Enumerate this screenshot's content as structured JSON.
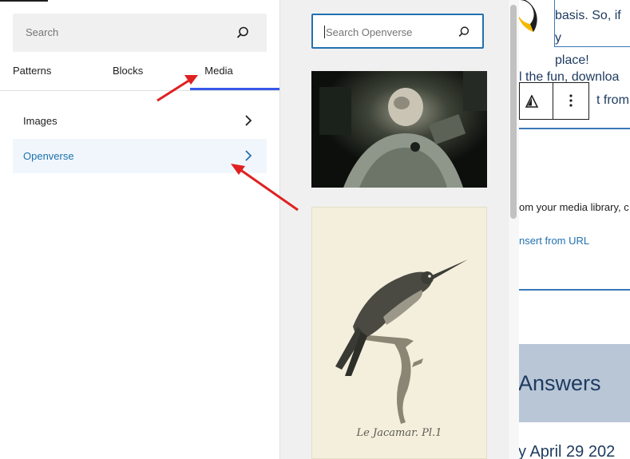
{
  "inserter": {
    "search_placeholder": "Search",
    "tabs": [
      {
        "label": "Patterns"
      },
      {
        "label": "Blocks"
      },
      {
        "label": "Media"
      }
    ],
    "active_tab": "Media",
    "categories": [
      {
        "label": "Images"
      },
      {
        "label": "Openverse"
      }
    ]
  },
  "media_panel": {
    "search_placeholder": "Search Openverse",
    "items": [
      {
        "kind": "photo",
        "subject": "astronaut"
      },
      {
        "kind": "engraving",
        "subject": "hummingbird",
        "caption": "Le Jacamar. Pl.1"
      }
    ]
  },
  "canvas": {
    "quote_lines": [
      "basis. So, if y",
      "place!"
    ],
    "para_line1": "l the fun, downloa",
    "para_line2": "t from C",
    "media_library_text": "om your media library, c",
    "insert_from_url": "nsert from URL",
    "answers_heading": "Answers",
    "date_text": "y April 29 202"
  },
  "colors": {
    "accent": "#3858e9",
    "link": "#2271b1",
    "openverse_highlight_bg": "#f0f6fc",
    "annotation_arrow": "#e02020",
    "answers_band": "#b8c6d6"
  },
  "icons": {
    "search": "search-icon",
    "chevron": "chevron-right-icon",
    "warning": "warning-icon",
    "more": "more-vertical-icon"
  }
}
